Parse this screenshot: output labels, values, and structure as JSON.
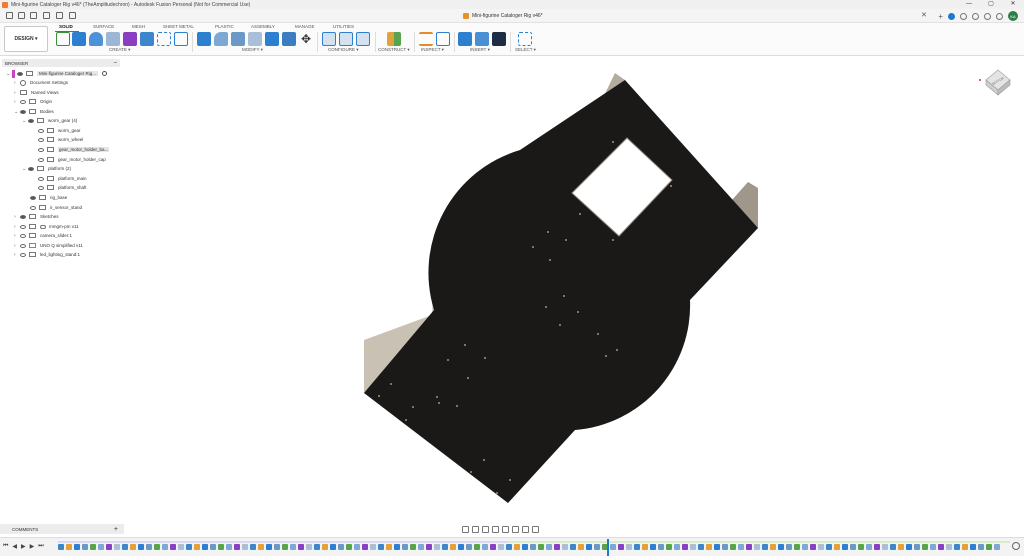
{
  "window": {
    "title": "Mini-figurine Cataloger Rig v46* (TheAmplitudechron) - Autodesk Fusion Personal (Not for Commercial Use)",
    "controls": [
      "—",
      "▢",
      "✕"
    ]
  },
  "document_tab": {
    "title": "Mini-figurine Cataloger Rig v46*"
  },
  "account": {
    "initials": "KA"
  },
  "ribbon": {
    "workspace_button": "DESIGN ▾",
    "tabs": [
      "SOLID",
      "SURFACE",
      "MESH",
      "SHEET METAL",
      "PLASTIC",
      "ASSEMBLY",
      "MANAGE",
      "UTILITIES"
    ],
    "active_tab": "SOLID",
    "groups": [
      "CREATE ▾",
      "MODIFY ▾",
      "CONFIGURE ▾",
      "CONSTRUCT ▾",
      "INSPECT ▾",
      "INSERT ▾",
      "SELECT ▾"
    ]
  },
  "browser": {
    "title": "BROWSER",
    "root": "Mini-figurine Cataloger Rig...",
    "items": [
      {
        "label": "Document Settings"
      },
      {
        "label": "Named Views"
      },
      {
        "label": "Origin"
      },
      {
        "label": "Bodies"
      },
      {
        "label": "worm_gear (4)"
      },
      {
        "label": "worm_gear"
      },
      {
        "label": "worm_wheel"
      },
      {
        "label": "gear_motor_holder_ba..."
      },
      {
        "label": "gear_motor_holder_cap"
      },
      {
        "label": "platform (2)"
      },
      {
        "label": "platform_main"
      },
      {
        "label": "platform_shaft"
      },
      {
        "label": "rig_base"
      },
      {
        "label": "ir_sensor_stand"
      },
      {
        "label": "Sketches"
      },
      {
        "label": "mmgm-pm v11"
      },
      {
        "label": "camera_slider:1"
      },
      {
        "label": "UNO Q simplified v11"
      },
      {
        "label": "led_lighting_stand:1"
      }
    ]
  },
  "comments": {
    "title": "COMMENTS"
  },
  "viewcube": {
    "face_label": "BOTTOM"
  },
  "colors": {
    "accent": "#1f78d1",
    "body_dark": "#1a1917",
    "wall_light": "#c9c2b4",
    "wall_shade": "#8f887b",
    "brand_orange": "#f27b2c"
  }
}
